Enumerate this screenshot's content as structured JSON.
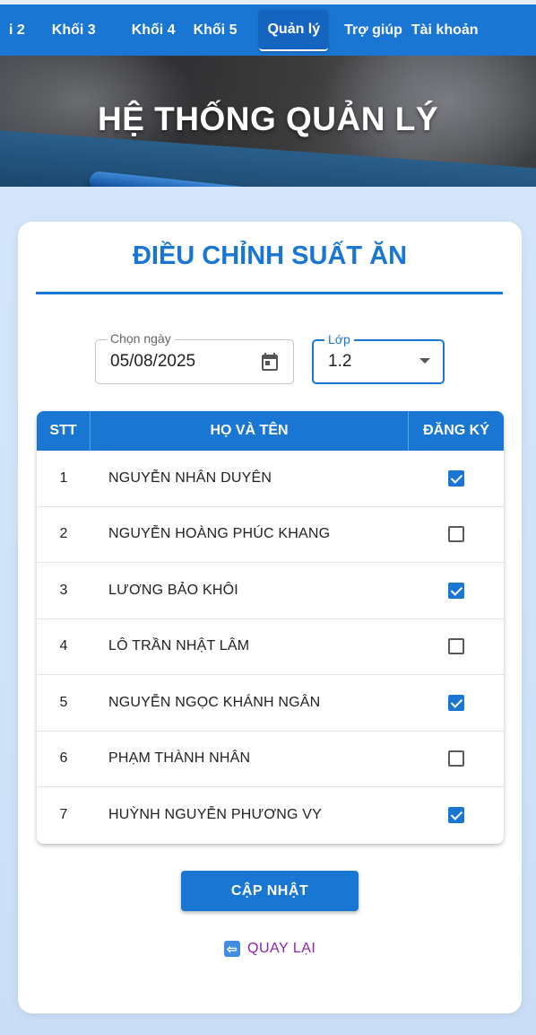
{
  "nav": {
    "items": [
      {
        "label": "i 2"
      },
      {
        "label": "Khối 3"
      },
      {
        "label": "Khối 4"
      },
      {
        "label": "Khối 5"
      },
      {
        "label": "Quản lý",
        "active": true
      },
      {
        "label": "Trợ giúp"
      },
      {
        "label": "Tài khoản"
      }
    ]
  },
  "hero": {
    "title": "HỆ THỐNG QUẢN LÝ"
  },
  "card": {
    "title": "ĐIỀU CHỈNH SUẤT ĂN"
  },
  "filters": {
    "date": {
      "label": "Chọn ngày",
      "value": "05/08/2025",
      "icon": "calendar-icon"
    },
    "class": {
      "label": "Lớp",
      "value": "1.2",
      "icon": "dropdown-caret-icon"
    }
  },
  "table": {
    "headers": {
      "stt": "STT",
      "name": "HỌ VÀ TÊN",
      "register": "ĐĂNG KÝ"
    },
    "rows": [
      {
        "stt": "1",
        "name": "NGUYỄN NHÂN DUYÊN",
        "checked": true
      },
      {
        "stt": "2",
        "name": "NGUYỄN HOÀNG PHÚC KHANG",
        "checked": false
      },
      {
        "stt": "3",
        "name": "LƯƠNG BẢO KHÔI",
        "checked": true
      },
      {
        "stt": "4",
        "name": "LÔ TRẦN NHẬT LÂM",
        "checked": false
      },
      {
        "stt": "5",
        "name": "NGUYỄN NGỌC KHÁNH NGÂN",
        "checked": true
      },
      {
        "stt": "6",
        "name": "PHẠM THÀNH NHÂN",
        "checked": false
      },
      {
        "stt": "7",
        "name": "HUỲNH NGUYỄN PHƯƠNG VY",
        "checked": true
      }
    ]
  },
  "actions": {
    "update_label": "CẬP NHẬT",
    "back_label": "QUAY LẠI",
    "back_icon": "back-arrow-icon"
  },
  "colors": {
    "primary": "#1976d2",
    "link": "#8e24aa"
  }
}
